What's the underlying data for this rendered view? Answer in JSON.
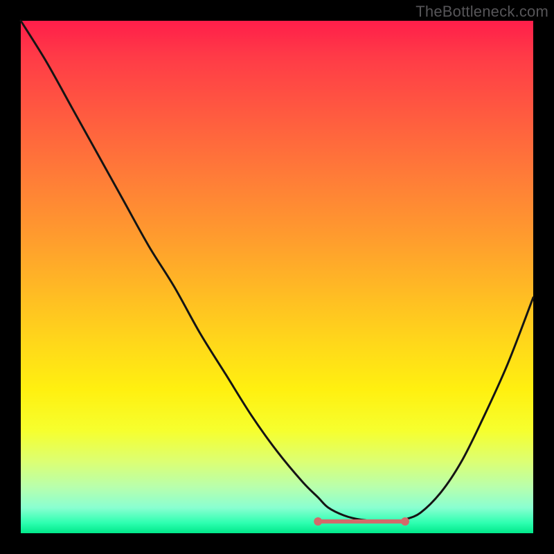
{
  "watermark": "TheBottleneck.com",
  "colors": {
    "page_bg": "#000000",
    "curve": "#141414",
    "highlight": "#d36a6a",
    "watermark_text": "#565558"
  },
  "chart_data": {
    "type": "line",
    "title": "",
    "xlabel": "",
    "ylabel": "",
    "xlim": [
      0,
      100
    ],
    "ylim": [
      0,
      100
    ],
    "grid": false,
    "legend": false,
    "series": [
      {
        "name": "bottleneck-curve",
        "x": [
          0,
          5,
          10,
          15,
          20,
          25,
          30,
          35,
          40,
          45,
          50,
          55,
          58,
          60,
          63,
          66,
          70,
          73,
          75,
          78,
          82,
          86,
          90,
          95,
          100
        ],
        "y": [
          100,
          92,
          83,
          74,
          65,
          56,
          48,
          39,
          31,
          23,
          16,
          10,
          7,
          5,
          3.5,
          2.7,
          2.3,
          2.3,
          2.7,
          4,
          8,
          14,
          22,
          33,
          46
        ]
      }
    ],
    "optimal_range": {
      "x_start": 58,
      "x_end": 75,
      "y": 2.3
    },
    "gradient_stops": [
      {
        "pos": 0.0,
        "color": "#ff1e4a"
      },
      {
        "pos": 0.3,
        "color": "#ff7b38"
      },
      {
        "pos": 0.63,
        "color": "#ffd81a"
      },
      {
        "pos": 0.86,
        "color": "#dcff73"
      },
      {
        "pos": 1.0,
        "color": "#00e88a"
      }
    ]
  }
}
